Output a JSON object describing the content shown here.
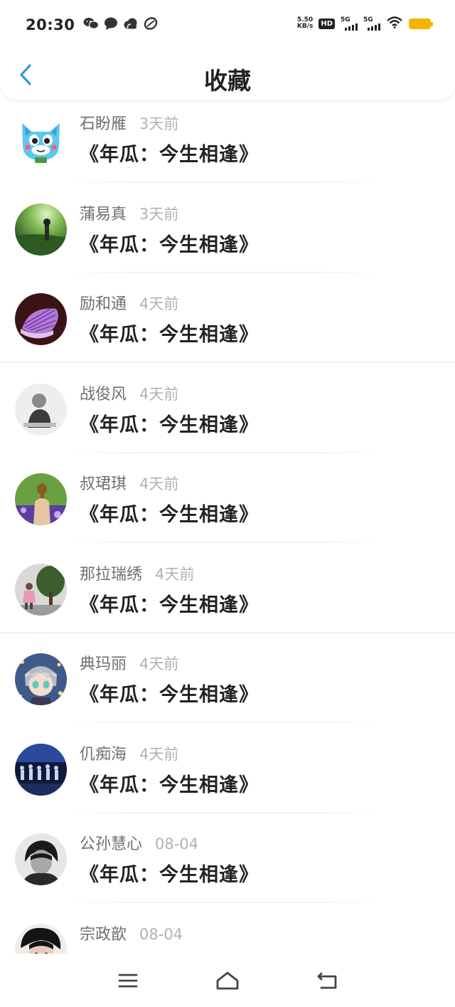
{
  "status_bar": {
    "time": "20:30",
    "net_speed_value": "5.50",
    "net_speed_unit": "KB/s",
    "hd_label": "HD",
    "sim1_label": "5G",
    "sim2_label": "5G",
    "battery_color": "#f5b400"
  },
  "header": {
    "title": "收藏",
    "back_icon": "chevron-left-icon",
    "accent_color": "#2e9ae6"
  },
  "items": [
    {
      "name": "石盼雁",
      "time": "3天前",
      "title": "《年瓜：今生相逢》",
      "avatar": "cartoon-cat"
    },
    {
      "name": "蒲易真",
      "time": "3天前",
      "title": "《年瓜：今生相逢》",
      "avatar": "green-landscape"
    },
    {
      "name": "励和通",
      "time": "4天前",
      "title": "《年瓜：今生相逢》",
      "avatar": "purple-shell"
    },
    {
      "name": "战俊风",
      "time": "4天前",
      "title": "《年瓜：今生相逢》",
      "avatar": "grayscale-person"
    },
    {
      "name": "叔珺琪",
      "time": "4天前",
      "title": "《年瓜：今生相逢》",
      "avatar": "girl-in-field"
    },
    {
      "name": "那拉瑞绣",
      "time": "4天前",
      "title": "《年瓜：今生相逢》",
      "avatar": "child-with-tree"
    },
    {
      "name": "典玛丽",
      "time": "4天前",
      "title": "《年瓜：今生相逢》",
      "avatar": "anime-character"
    },
    {
      "name": "仉痴海",
      "time": "4天前",
      "title": "《年瓜：今生相逢》",
      "avatar": "dance-group"
    },
    {
      "name": "公孙慧心",
      "time": "08-04",
      "title": "《年瓜：今生相逢》",
      "avatar": "bw-portrait"
    },
    {
      "name": "宗政歆",
      "time": "08-04",
      "title": "",
      "avatar": "dark-hair-portrait"
    }
  ],
  "nav_bar": {
    "menu_icon": "menu-icon",
    "home_icon": "home-icon",
    "back_icon": "return-icon"
  }
}
